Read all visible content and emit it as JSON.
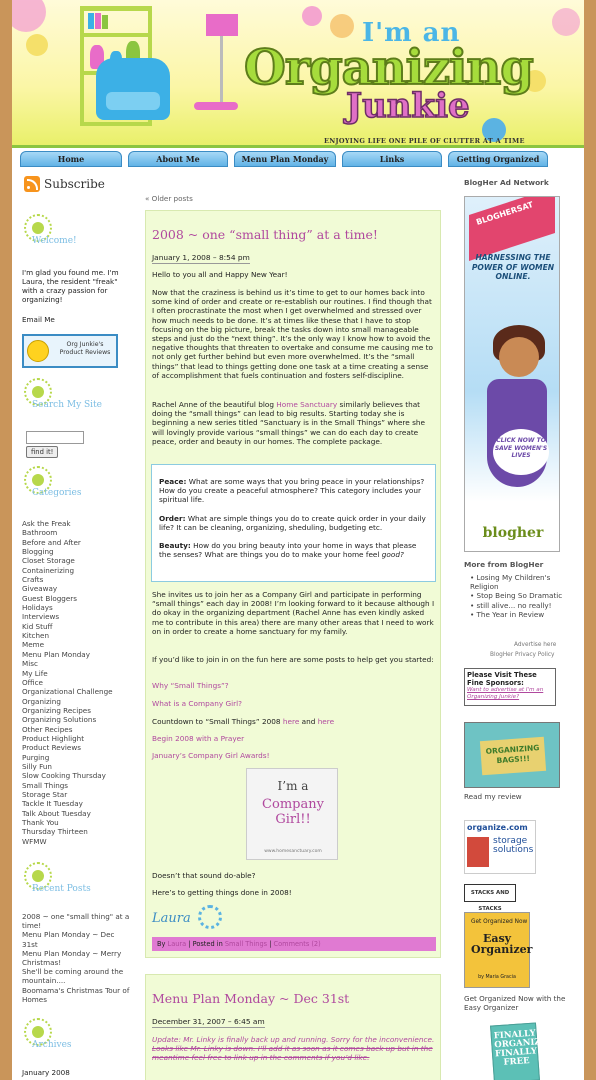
{
  "header": {
    "title_line1": "I'm an",
    "title_line2": "Organizing",
    "title_line3": "Junkie",
    "tagline": "ENJOYING LIFE ONE PILE OF CLUTTER AT A TIME"
  },
  "nav": {
    "tabs": [
      "Home",
      "About Me",
      "Menu Plan Monday",
      "Links",
      "Getting Organized"
    ]
  },
  "left": {
    "subscribe": "Subscribe",
    "welcome_heading": "Welcome!",
    "welcome_text": "I'm glad you found me. I'm Laura, the resident \"freak\" with a crazy passion for organizing!",
    "email_me": "Email Me",
    "product_reviews_button": "Org Junkie's Product Reviews",
    "search_heading": "Search My Site",
    "find_button": "find it!",
    "categories_heading": "Categories",
    "categories": [
      "Ask the Freak",
      "Bathroom",
      "Before and After",
      "Blogging",
      "Closet Storage",
      "Containerizing",
      "Crafts",
      "Giveaway",
      "Guest Bloggers",
      "Holidays",
      "Interviews",
      "Kid Stuff",
      "Kitchen",
      "Meme",
      "Menu Plan Monday",
      "Misc",
      "My Life",
      "Office",
      "Organizational Challenge",
      "Organizing",
      "Organizing Recipes",
      "Organizing Solutions",
      "Other Recipes",
      "Product Highlight",
      "Product Reviews",
      "Purging",
      "Silly Fun",
      "Slow Cooking Thursday",
      "Small Things",
      "Storage Star",
      "Tackle It Tuesday",
      "Talk About Tuesday",
      "Thank You",
      "Thursday Thirteen",
      "WFMW"
    ],
    "recent_heading": "Recent Posts",
    "recent_posts": [
      "2008 ~ one \"small thing\" at a time!",
      "Menu Plan Monday ~ Dec 31st",
      "Menu Plan Monday ~ Merry Christmas!",
      "She'll be coming around the mountain....",
      "Boomama's Christmas Tour of Homes"
    ],
    "archives_heading": "Archives",
    "archives": [
      "January 2008"
    ]
  },
  "main": {
    "older_posts": "« Older posts",
    "post1": {
      "title": "2008 ~ one “small thing” at a time!",
      "date": "January 1, 2008 – 8:54 pm",
      "p1": "Hello to you all and Happy New Year!",
      "p2": "Now that the craziness is behind us it’s time to get to our homes back into some kind of order and create or re-establish our routines. I find though that I often procrastinate the most when I get overwhelmed and stressed over how much needs to be done. It’s at times like these that I have to stop focusing on the big picture, break the tasks down into small manageable steps and just do the “next thing”. It’s the only way I know how to avoid the negative thoughts that threaten to overtake and consume me causing me to not only get further behind but even more overwhelmed. It’s the “small things” that lead to things getting done one task at a time creating a sense of accomplishment that fuels continuation and fosters self-discipline.",
      "p3_a": "Rachel Anne of the beautiful blog ",
      "p3_link": "Home Sanctuary",
      "p3_b": " similarly believes that doing the “small things” can lead to big results. Starting today she is beginning a new series titled “Sanctuary is in the Small Things” where she will lovingly provide various “small things” we can do each day to create peace, order and beauty in our homes. The complete package.",
      "q_peace_label": "Peace:",
      "q_peace": " What are some ways that you bring peace in your relationships? How do you create a peaceful atmosphere? This category includes your spiritual life.",
      "q_order_label": "Order:",
      "q_order": " What are simple things you do to create quick order in your daily life? It can be cleaning, organizing, sheduling, budgeting etc.",
      "q_beauty_label": "Beauty:",
      "q_beauty": " How do you bring beauty into your home in ways that please the senses? What are things you do to make your home feel ",
      "q_beauty_em": "good?",
      "p4": "She invites us to join her as a Company Girl and participate in performing “small things” each day in 2008! I’m looking forward to it because although I do okay in the organizing department (Rachel Anne has even kindly asked me to contribute in this area) there are many other areas that I need to work on in order to create a home sanctuary for my family.",
      "p5": "If you’d like to join in on the fun here are some posts to help get you started:",
      "link1": "Why “Small Things”?",
      "link2": "What is a Company Girl?",
      "countdown_a": "Countdown to “Small Things” 2008 ",
      "countdown_here1": "here",
      "countdown_and": " and ",
      "countdown_here2": "here",
      "link3": "Begin 2008 with a Prayer",
      "link4": "January’s Company Girl Awards!",
      "badge_line1": "I’m a",
      "badge_line2": "Company Girl!!",
      "badge_url": "www.homesanctuary.com",
      "p6": "Doesn’t that sound do-able?",
      "p7": "Here’s to getting things done in 2008!",
      "signature": "Laura",
      "byline_by": "By ",
      "byline_author": "Laura",
      "byline_posted": " | Posted in ",
      "byline_cat": "Small Things",
      "byline_sep": " | ",
      "byline_comments": "Comments (2)"
    },
    "post2": {
      "title": "Menu Plan Monday ~ Dec 31st",
      "date": "December 31, 2007 – 6:45 am",
      "update_label": "Update",
      "update_text": ": Mr. Linky is finally back up and running. Sorry for the inconvenience. ",
      "strike_text": "Looks like Mr. Linky is down. I’ll add it as soon as it comes back up but in the meantime feel free to link up in the comments if you’d like."
    }
  },
  "right": {
    "ad_heading": "BlogHer Ad Network",
    "ad_banner": "BLOGHERSAT",
    "ad_headline": "HARNESSING THE POWER OF WOMEN ONLINE.",
    "ad_cta": "CLICK NOW TO SAVE WOMEN'S LIVES",
    "ad_logo": "blogher",
    "more_heading": "More from BlogHer",
    "more_items": [
      "Losing My Children's Religion",
      "Stop Being So Dramatic",
      "still alive... no really!",
      "The Year in Review"
    ],
    "advertise_here": "Advertise here",
    "privacy": "BlogHer Privacy Policy",
    "sponsors_title": "Please Visit These Fine Sponsors:",
    "sponsors_link": "Want to advertise at I'm an Organizing Junkie?",
    "bags_text": "ORGANIZING BAGS!!!",
    "read_review": "Read my review",
    "orgcom_name": "organize.com",
    "orgcom_sub": "storage solutions",
    "stacks": "STACKS AND STACKS",
    "book_title": "Easy Organizer",
    "book_top": "Get Organized Now",
    "book_by": "by Maria Gracia",
    "get_organized": "Get Organized Now with the Easy Organizer",
    "book3_title": "FINALLY ORGANIZED, FINALLY FREE"
  }
}
